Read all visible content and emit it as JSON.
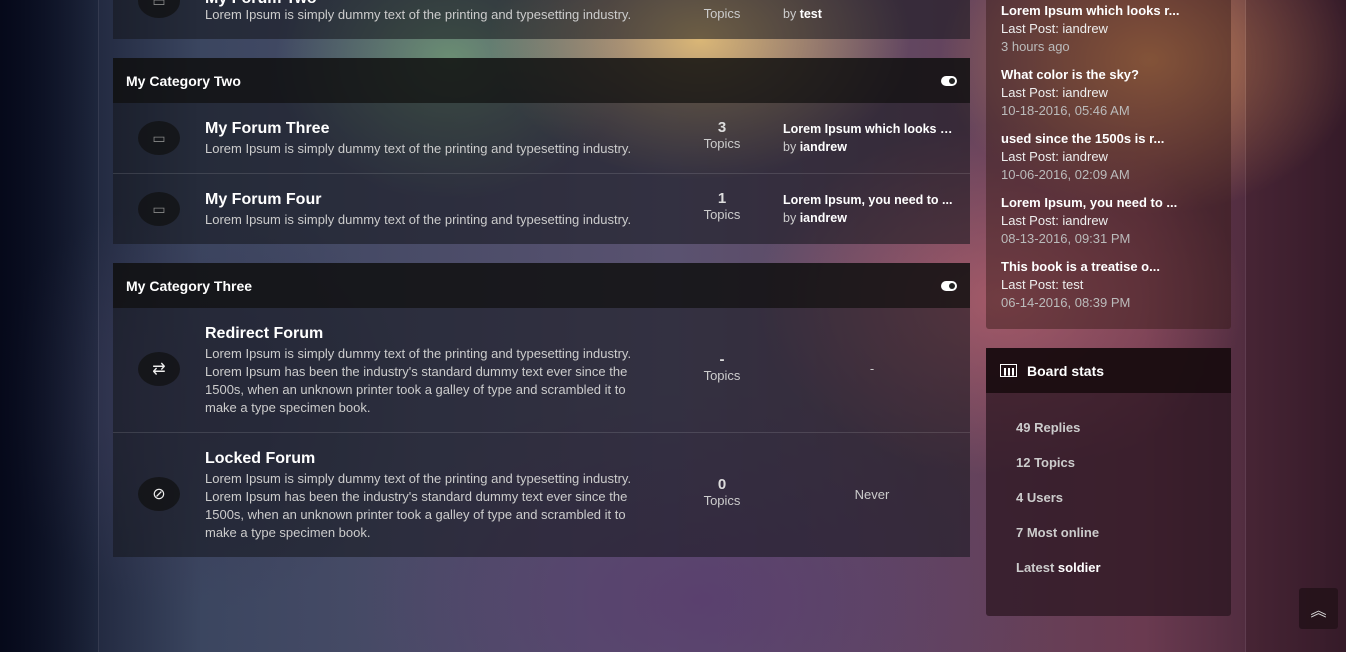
{
  "categories": [
    {
      "title": "My Forum Two",
      "forums": [
        {
          "title": "My Forum Two",
          "desc": "Lorem Ipsum is simply dummy text of the printing and typesetting industry.",
          "count": "",
          "count_label": "Topics",
          "last_by_label": "by",
          "last_by": "test"
        }
      ]
    },
    {
      "title": "My Category Two",
      "forums": [
        {
          "title": "My Forum Three",
          "desc": "Lorem Ipsum is simply dummy text of the printing and typesetting industry.",
          "count": "3",
          "count_label": "Topics",
          "last_title": "Lorem Ipsum which looks r...",
          "last_by_label": "by",
          "last_by": "iandrew"
        },
        {
          "title": "My Forum Four",
          "desc": "Lorem Ipsum is simply dummy text of the printing and typesetting industry.",
          "count": "1",
          "count_label": "Topics",
          "last_title": "Lorem Ipsum, you need to ...",
          "last_by_label": "by",
          "last_by": "iandrew"
        }
      ]
    },
    {
      "title": "My Category Three",
      "forums": [
        {
          "title": "Redirect Forum",
          "desc": "Lorem Ipsum is simply dummy text of the printing and typesetting industry. Lorem Ipsum has been the industry's standard dummy text ever since the 1500s, when an unknown printer took a galley of type and scrambled it to make a type specimen book.",
          "count": "-",
          "count_label": "Topics",
          "last": "-"
        },
        {
          "title": "Locked Forum",
          "desc": "Lorem Ipsum is simply dummy text of the printing and typesetting industry. Lorem Ipsum has been the industry's standard dummy text ever since the 1500s, when an unknown printer took a galley of type and scrambled it to make a type specimen book.",
          "count": "0",
          "count_label": "Topics",
          "last": "Never"
        }
      ]
    }
  ],
  "latest_posts": [
    {
      "title": "Lorem Ipsum which looks r...",
      "author": "Last Post: iandrew",
      "date": "3 hours ago"
    },
    {
      "title": "What color is the sky?",
      "author": "Last Post: iandrew",
      "date": "10-18-2016, 05:46 AM"
    },
    {
      "title": "used since the 1500s is r...",
      "author": "Last Post: iandrew",
      "date": "10-06-2016, 02:09 AM"
    },
    {
      "title": "Lorem Ipsum, you need to ...",
      "author": "Last Post: iandrew",
      "date": "08-13-2016, 09:31 PM"
    },
    {
      "title": "This book is a treatise o...",
      "author": "Last Post: test",
      "date": "06-14-2016, 08:39 PM"
    }
  ],
  "board_stats": {
    "title": "Board stats",
    "items": [
      "49 Replies",
      "12 Topics",
      "4 Users",
      "7 Most online"
    ],
    "latest_label": "Latest",
    "latest_user": "soldier"
  },
  "scroll_top_icon": "double-chevron-up-icon"
}
